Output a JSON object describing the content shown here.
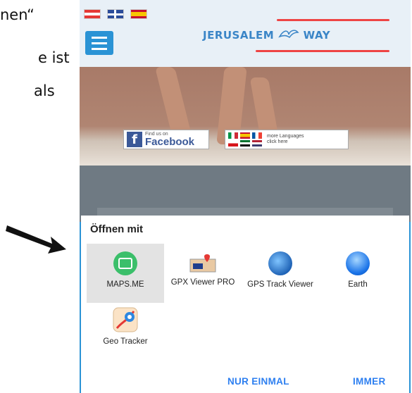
{
  "document": {
    "line1": "nen“",
    "line2": "e ist",
    "line3": "als"
  },
  "website": {
    "logo_text": "JERUSALEM ⁠WAY",
    "logo_left": "JERUSALEM",
    "logo_right": "WAY",
    "flags": [
      "german-flag",
      "uk-flag",
      "spanish-flag"
    ],
    "facebook_small": "Find us on",
    "facebook_big": "Facebook",
    "languages_line1": "more Languages",
    "languages_line2": "click here"
  },
  "sheet": {
    "title": "Öffnen mit",
    "apps": [
      {
        "label": "MAPS.ME",
        "icon": "maps-me-icon",
        "selected": true
      },
      {
        "label": "GPX Viewer PRO",
        "icon": "gpx-viewer-pro-icon",
        "selected": false
      },
      {
        "label": "GPS Track Viewer",
        "icon": "gps-track-viewer-icon",
        "selected": false
      },
      {
        "label": "Earth",
        "icon": "google-earth-icon",
        "selected": false
      },
      {
        "label": "Geo Tracker",
        "icon": "geo-tracker-icon",
        "selected": false
      }
    ],
    "btn_once": "NUR EINMAL",
    "btn_always": "IMMER"
  },
  "colors": {
    "phone_blue": "#2a93d5",
    "accent_button": "#2d7ff0",
    "selected_tile": "#e3e3e3"
  }
}
